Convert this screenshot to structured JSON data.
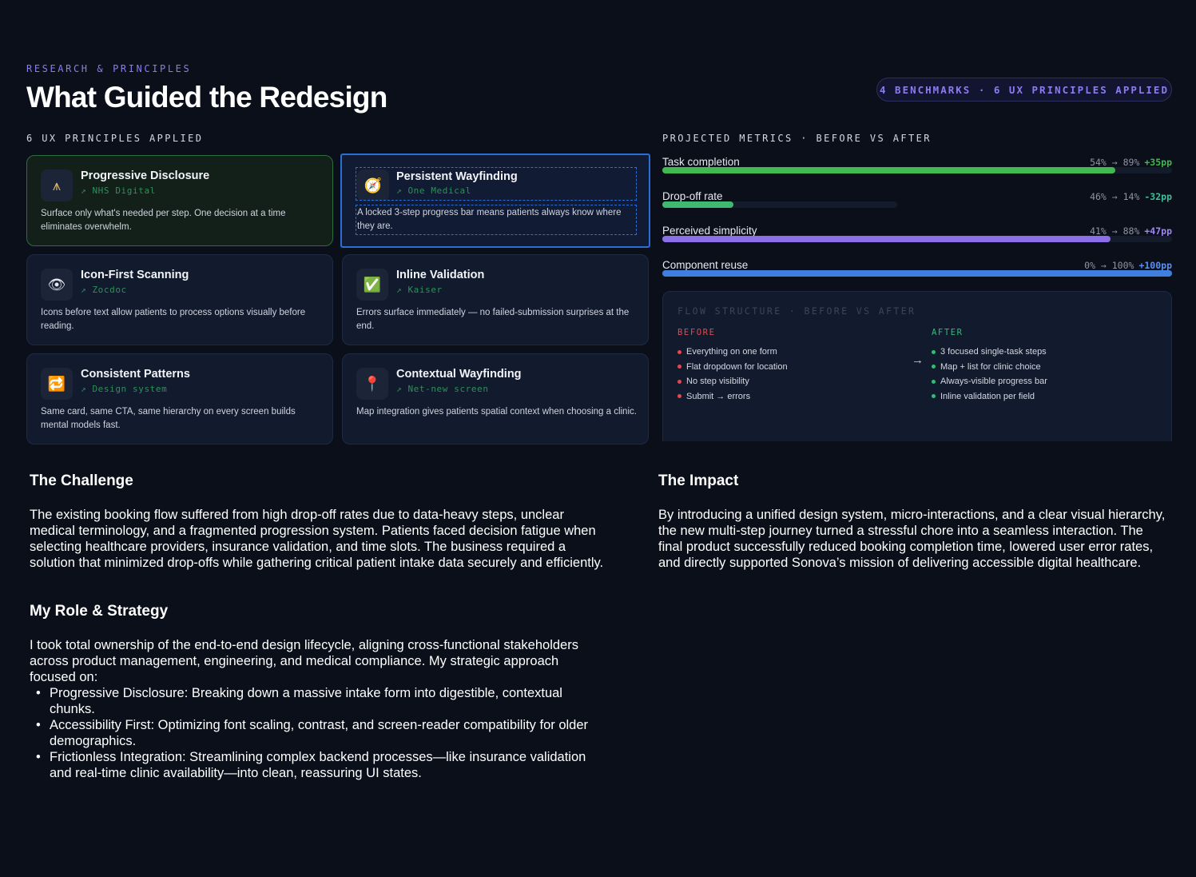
{
  "header": {
    "eyebrow": "RESEARCH & PRINCIPLES",
    "title": "What Guided the Redesign",
    "badge": "4 BENCHMARKS · 6 UX PRINCIPLES APPLIED"
  },
  "principles": {
    "label": "6 UX PRINCIPLES APPLIED",
    "cards": [
      {
        "icon": "ladder-icon",
        "glyph": "⩚",
        "title": "Progressive Disclosure",
        "source": "↗ NHS Digital",
        "desc": "Surface only what's needed per step. One decision at a time eliminates overwhelm."
      },
      {
        "icon": "compass-icon",
        "glyph": "🧭",
        "title": "Persistent Wayfinding",
        "source": "↗ One Medical",
        "desc": "A locked 3-step progress bar means patients always know where they are."
      },
      {
        "icon": "eye-icon",
        "glyph": "👁",
        "title": "Icon-First Scanning",
        "source": "↗ Zocdoc",
        "desc": "Icons before text allow patients to process options visually before reading."
      },
      {
        "icon": "check-icon",
        "glyph": "✅",
        "title": "Inline Validation",
        "source": "↗ Kaiser",
        "desc": "Errors surface immediately — no failed-submission surprises at the end."
      },
      {
        "icon": "repeat-icon",
        "glyph": "🔁",
        "title": "Consistent Patterns",
        "source": "↗ Design system",
        "desc": "Same card, same CTA, same hierarchy on every screen builds mental models fast."
      },
      {
        "icon": "map-pin-icon",
        "glyph": "📍",
        "title": "Contextual Wayfinding",
        "source": "↗ Net-new screen",
        "desc": "Map integration gives patients spatial context when choosing a clinic."
      }
    ]
  },
  "metrics": {
    "label": "PROJECTED METRICS · BEFORE VS AFTER",
    "items": [
      {
        "label": "Task completion",
        "vals": "54% → 89%",
        "delta": "+35pp",
        "after": 0.89,
        "after_pct": "89%",
        "color": "#3fb950",
        "delta_color": "#3fb950",
        "track_pct": "100%"
      },
      {
        "label": "Drop-off rate",
        "vals": "46% → 14%",
        "delta": "-32pp",
        "after": 0.14,
        "after_pct": "14%",
        "color": "#3fb970",
        "delta_color": "#3fbf9a",
        "track_pct": "46%"
      },
      {
        "label": "Perceived simplicity",
        "vals": "41% → 88%",
        "delta": "+47pp",
        "after": 0.88,
        "after_pct": "88%",
        "color": "#8b6fe8",
        "delta_color": "#9d86f5",
        "track_pct": "100%"
      },
      {
        "label": "Component reuse",
        "vals": "0% → 100%",
        "delta": "+100pp",
        "after": 1.0,
        "after_pct": "100%",
        "color": "#3f7fe0",
        "delta_color": "#5a8ff0",
        "track_pct": "100%"
      }
    ]
  },
  "flow": {
    "title": "FLOW STRUCTURE · BEFORE VS AFTER",
    "before_label": "BEFORE",
    "after_label": "AFTER",
    "before": [
      "Everything on one form",
      "Flat dropdown for location",
      "No step visibility",
      "Submit → errors"
    ],
    "after": [
      "3 focused single-task steps",
      "Map + list for clinic choice",
      "Always-visible progress bar",
      "Inline validation per field"
    ],
    "before_color": "#e5484d",
    "after_color": "#2fbf71"
  },
  "challenge": {
    "title": "The Challenge",
    "body": "The existing booking flow suffered from high drop-off rates due to data-heavy steps, unclear medical terminology, and a fragmented progression system. Patients faced decision fatigue when selecting healthcare providers, insurance validation, and time slots. The business required a solution that minimized drop-offs while gathering critical patient intake data securely and efficiently."
  },
  "role": {
    "title": "My Role & Strategy",
    "body": "I took total ownership of the end-to-end design lifecycle, aligning cross-functional stakeholders across product management, engineering, and medical compliance. My strategic approach focused on:",
    "bullets": [
      "Progressive Disclosure: Breaking down a massive intake form into digestible, contextual chunks.",
      "Accessibility First: Optimizing font scaling, contrast, and screen-reader compatibility for older demographics.",
      "Frictionless Integration: Streamlining complex backend processes—like insurance validation and real-time clinic availability—into clean, reassuring UI states."
    ]
  },
  "impact": {
    "title": "The Impact",
    "body": "By introducing a unified design system, micro-interactions, and a clear visual hierarchy, the new multi-step journey turned a stressful chore into a seamless interaction. The final product successfully reduced booking completion time, lowered user error rates, and directly supported Sonova’s mission of delivering accessible digital healthcare."
  }
}
